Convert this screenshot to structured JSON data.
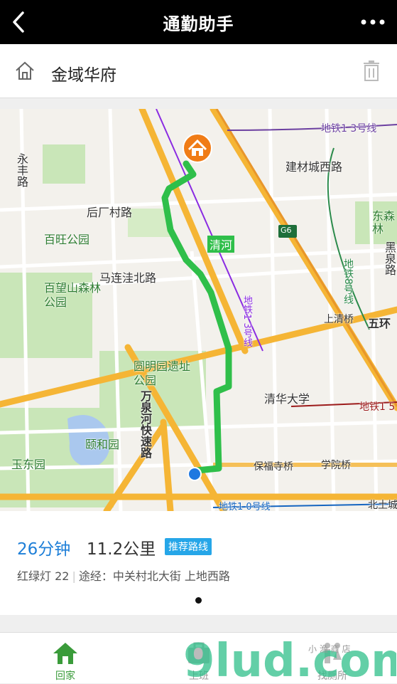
{
  "header": {
    "title": "通勤助手"
  },
  "destination": {
    "name": "金域华府"
  },
  "map": {
    "labels": {
      "subway13": "地铁1 3号线",
      "jiancai": "建材城西路",
      "yongfeng": "永丰路",
      "houchang": "后厂村路",
      "baiwang": "百旺公园",
      "qinghe": "清河",
      "g6": "G6",
      "dongsen": "东森林",
      "heiquan": "黑泉路",
      "malianwa": "马连洼北路",
      "baiwangshan": "百望山森林公园",
      "subway8": "地铁8号线",
      "subway13b": "地铁1 3号线",
      "shangqing": "上清桥",
      "wuhuan": "五环",
      "yuanmingyuan": "圆明园遗址公园",
      "tsinghua": "清华大学",
      "subway15": "地铁1 5",
      "wanquan": "万泉河快速路",
      "yiheyuan": "颐和园",
      "yudong": "玉东园",
      "baofusi": "保福寺桥",
      "xueyuan": "学院桥",
      "subway10": "地铁1 0号线",
      "beitu": "北土城"
    },
    "colors": {
      "route": "#2fbf4a",
      "highway": "#f5b535",
      "park": "#c9e6b8"
    }
  },
  "route": {
    "time": "26分钟",
    "distance": "11.2公里",
    "tag": "推荐路线",
    "lights": "红绿灯 22",
    "via": "途经：中关村北大街 上地西路"
  },
  "tabs": [
    {
      "label": "回家",
      "icon": "home-icon",
      "active": true
    },
    {
      "label": "上班",
      "icon": "briefcase-icon",
      "active": false
    },
    {
      "label": "找厕所",
      "icon": "toilet-icon",
      "active": false
    }
  ],
  "watermark": {
    "brand": "9lud.com",
    "sub": "小 渔 商 店"
  }
}
